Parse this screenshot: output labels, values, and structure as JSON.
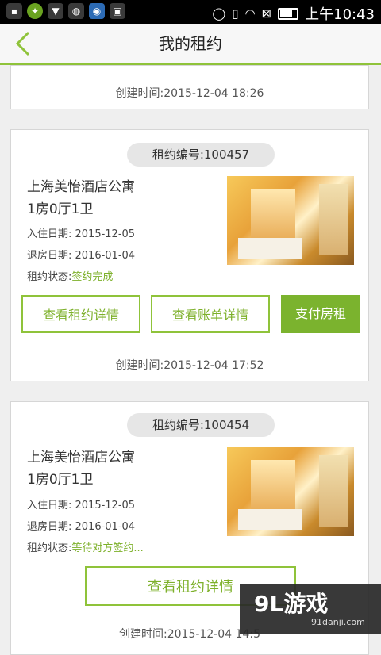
{
  "status_bar": {
    "time": "上午10:43",
    "icons": [
      "notification-icon",
      "app-icon",
      "shield-icon",
      "speed-icon",
      "browser-icon",
      "image-icon",
      "alarm-icon",
      "vibrate-icon",
      "wifi-icon",
      "no-sim-icon",
      "battery-icon"
    ]
  },
  "header": {
    "title": "我的租约",
    "back_icon": "chevron-left-icon"
  },
  "cards": [
    {
      "created": "创建时间:2015-12-04 18:26"
    },
    {
      "rent_no": "租约编号:100457",
      "apartment": "上海美怡酒店公寓",
      "layout": "1房0厅1卫",
      "checkin": "入住日期: 2015-12-05",
      "checkout": "退房日期: 2016-01-04",
      "status_label": "租约状态:",
      "status_value": "签约完成",
      "buttons": [
        "查看租约详情",
        "查看账单详情",
        "支付房租"
      ],
      "created": "创建时间:2015-12-04 17:52"
    },
    {
      "rent_no": "租约编号:100454",
      "apartment": "上海美怡酒店公寓",
      "layout": "1房0厅1卫",
      "checkin": "入住日期: 2015-12-05",
      "checkout": "退房日期: 2016-01-04",
      "status_label": "租约状态:",
      "status_value": "等待对方签约...",
      "buttons": [
        "查看租约详情"
      ],
      "created": "创建时间:2015-12-04 14:5"
    }
  ],
  "watermark": {
    "big": "9L游戏",
    "small": "91danji.com"
  },
  "colors": {
    "accent": "#7bb32e",
    "background": "#efefef"
  }
}
